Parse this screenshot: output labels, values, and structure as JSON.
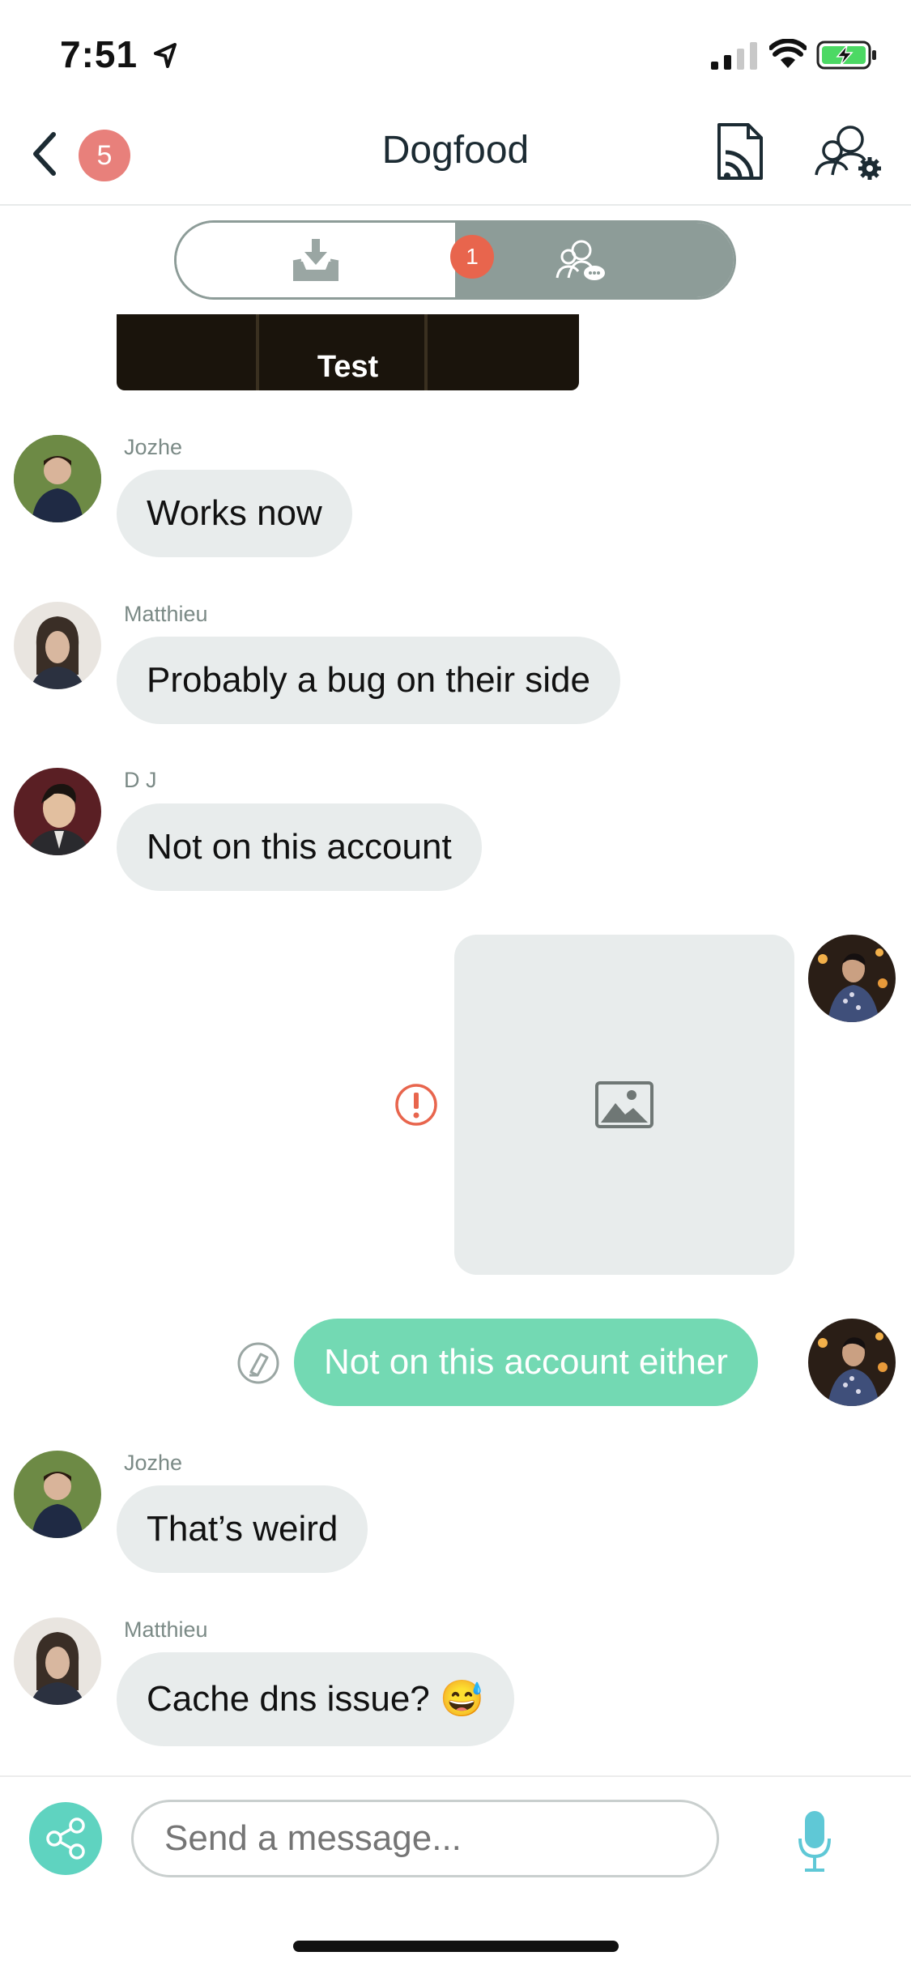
{
  "status_bar": {
    "time": "7:51"
  },
  "header": {
    "title": "Dogfood",
    "back_badge": "5"
  },
  "segmented": {
    "chat_badge": "1"
  },
  "test_image": {
    "label": "Test"
  },
  "messages": [
    {
      "sender": "Jozhe",
      "text": "Works now"
    },
    {
      "sender": "Matthieu",
      "text": "Probably a bug on their side"
    },
    {
      "sender": "D J",
      "text": "Not on this account"
    },
    {
      "sender": "",
      "text": "Not on this account either"
    },
    {
      "sender": "Jozhe",
      "text": "That’s weird"
    },
    {
      "sender": "Matthieu",
      "text": "Cache dns issue? 😅"
    }
  ],
  "composer": {
    "placeholder": "Send a message..."
  },
  "colors": {
    "accent": "#73d9b3",
    "badge": "#e8807b",
    "segment": "#8d9c98",
    "error": "#e8654d",
    "mic": "#5fc8d6"
  }
}
